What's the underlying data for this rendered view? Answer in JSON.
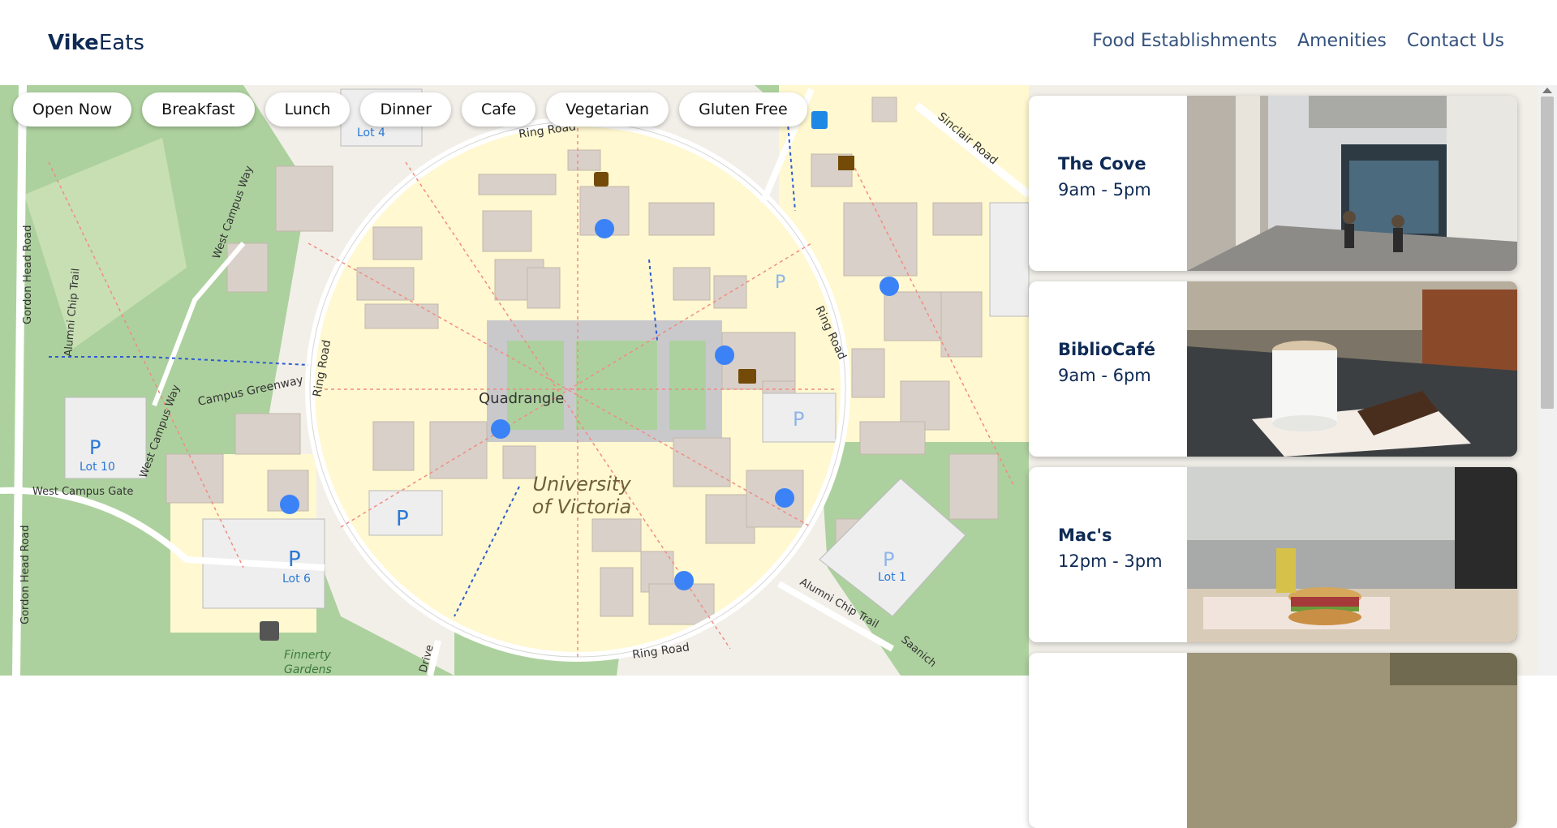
{
  "brand": {
    "bold": "Vike",
    "regular": "Eats"
  },
  "nav": [
    "Food Establishments",
    "Amenities",
    "Contact Us"
  ],
  "filters": [
    "Open Now",
    "Breakfast",
    "Lunch",
    "Dinner",
    "Cafe",
    "Vegetarian",
    "Gluten Free"
  ],
  "map": {
    "labels": {
      "quad": "Quadrangle",
      "uvic1": "University",
      "uvic2": "of Victoria",
      "ring_road": "Ring Road",
      "sinclair": "Sinclair Road",
      "gordon": "Gordon Head Road",
      "west_campus_way": "West Campus Way",
      "alumni": "Alumni Chip Trail",
      "greenway": "Campus Greenway",
      "west_gate": "West Campus Gate",
      "lot10": "Lot 10",
      "lot6": "Lot 6",
      "lot4": "Lot 4",
      "lot1": "Lot 1",
      "finnerty1": "Finnerty",
      "finnerty2": "Gardens",
      "saanich": "Saanich",
      "drive": "Drive",
      "parking": "P"
    }
  },
  "establishments": [
    {
      "name": "The Cove",
      "hours": "9am - 5pm"
    },
    {
      "name": "BiblioCafé",
      "hours": "9am - 6pm"
    },
    {
      "name": "Mac's",
      "hours": "12pm - 3pm"
    }
  ],
  "colors": {
    "primary": "#0e2a55",
    "marker": "#3b82f6"
  }
}
